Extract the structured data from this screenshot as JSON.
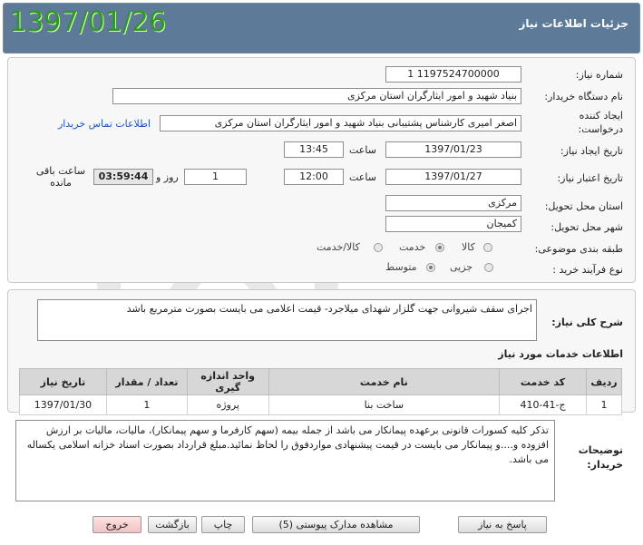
{
  "header": {
    "title": "جزئیات اطلاعات نیاز",
    "date": "1397/01/26"
  },
  "form": {
    "need_number_label": "شماره نیاز:",
    "need_number": "1197524700000 1",
    "buyer_org_label": "نام دستگاه خریدار:",
    "buyer_org": "بنیاد شهید و امور ایثارگران استان مرکزی",
    "requester_label_1": "ایجاد کننده",
    "requester_label_2": "درخواست:",
    "requester": "اصغر امیری کارشناس پشتیبانی بنیاد شهید و امور ایثارگران استان مرکزی",
    "contact_link": "اطلاعات تماس خریدار",
    "created_label": "تاریخ ایجاد نیاز:",
    "created_date": "1397/01/23",
    "created_time_label": "ساعت",
    "created_time": "13:45",
    "deadline_label": "تاریخ اعتبار نیاز:",
    "deadline_date": "1397/01/27",
    "deadline_time_label": "ساعت",
    "deadline_time": "12:00",
    "days": "1",
    "days_label": "روز و",
    "remaining": "03:59:44",
    "remaining_label": "ساعت باقی مانده",
    "province_label": "استان محل تحویل:",
    "province": "مرکزی",
    "city_label": "شهر محل تحویل:",
    "city": "کمیجان",
    "category_label": "طبقه بندی موضوعی:",
    "category_options": [
      "کالا",
      "خدمت",
      "کالا/خدمت"
    ],
    "category_selected": "خدمت",
    "process_label": "نوع فرآیند خرید :",
    "process_options": [
      "جزیی",
      "متوسط"
    ],
    "process_selected": "متوسط"
  },
  "description": {
    "label": "شرح کلی نیاز:",
    "text": "اجرای سقف شیروانی جهت گلزار شهدای میلاجرد- قیمت اعلامی می بایست بصورت مترمربع باشد"
  },
  "services": {
    "title": "اطلاعات خدمات مورد نیاز",
    "columns": [
      "ردیف",
      "کد خدمت",
      "نام خدمت",
      "واحد اندازه گیری",
      "تعداد / مقدار",
      "تاریخ نیاز"
    ],
    "rows": [
      [
        "1",
        "ج-41-410",
        "ساخت بنا",
        "پروژه",
        "1",
        "1397/01/30"
      ]
    ]
  },
  "buyer_notes": {
    "label": "توضیحات خریدار:",
    "text": "تذکر کلیه کسورات قانونی برعهده پیمانکار می باشد از جمله بیمه (سهم کارفرما و سهم پیمانکار)، مالیات، مالیات بر ارزش افزوده و....و پیمانکار می بایست در قیمت پیشنهادی مواردفوق را لحاظ نمائید.مبلغ قرارداد بصورت اسناد خزانه اسلامی یکساله می باشد."
  },
  "buttons": {
    "reply": "پاسخ به نیاز",
    "attachments": "مشاهده مدارک پیوستی (5)",
    "print": "چاپ",
    "back": "بازگشت",
    "exit": "خروج"
  },
  "colors": {
    "header_bg": "#5e7a99",
    "date_green": "#2e9a1d",
    "link_blue": "#1a59c7"
  }
}
